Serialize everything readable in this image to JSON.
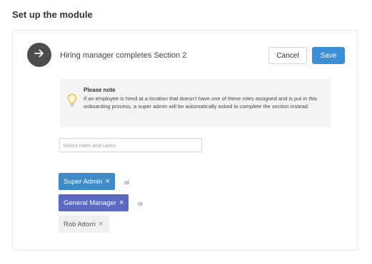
{
  "page": {
    "title": "Set up the module"
  },
  "step": {
    "icon": "arrow-right-icon",
    "title": "Hiring manager completes Section 2",
    "cancel_label": "Cancel",
    "save_label": "Save",
    "colors": {
      "save": "#3b8fd6",
      "step_circle": "#4d4d4d"
    }
  },
  "note": {
    "icon": "lightbulb-icon",
    "title": "Please note",
    "text": "If an employee is hired at a location that doesn't have one of these roles assigned and is put in this onboarding process, a super admin will be automatically asked to complete the section instead."
  },
  "assignee_select": {
    "placeholder": "Select roles and users",
    "value": ""
  },
  "assignees": [
    {
      "label": "Super Admin",
      "remove_icon": "close-icon",
      "color": "#3f8bc9"
    },
    {
      "label": "General Manager",
      "remove_icon": "close-icon",
      "color": "#5b6ac0"
    },
    {
      "label": "Rob Attorri",
      "remove_icon": "close-icon",
      "color": "#eef0f2"
    }
  ],
  "separator": "or",
  "remove_glyph": "×"
}
